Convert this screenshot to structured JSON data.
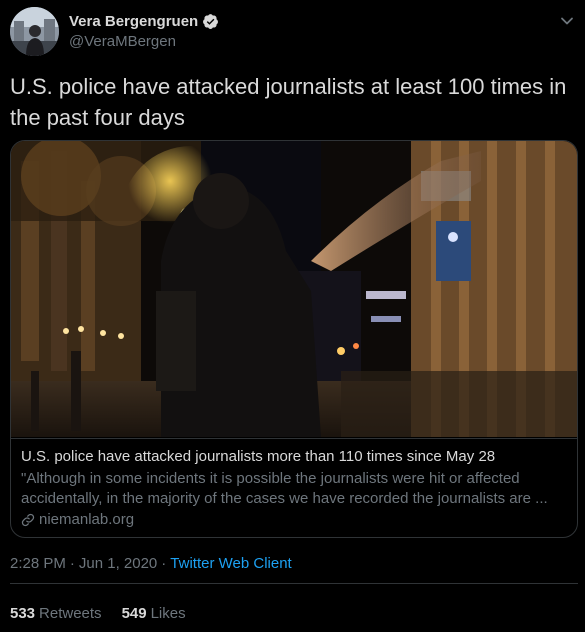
{
  "author": {
    "display_name": "Vera Bergengruen",
    "handle": "@VeraMBergen",
    "verified": true,
    "avatar_icon": "avatar-photo"
  },
  "tweet": {
    "text": "U.S. police have attacked journalists at least 100 times in the past four days"
  },
  "card": {
    "image_description_icon": "night-street-protest-photo",
    "title": "U.S. police have attacked journalists more than 110 times since May 28",
    "description_line1": "\"Although in some incidents it is possible the journalists were hit or affected",
    "description_line2": "accidentally, in the majority of the cases we have recorded the journalists are ...",
    "domain": "niemanlab.org"
  },
  "meta": {
    "time": "2:28 PM",
    "date": "Jun 1, 2020",
    "separator": "·",
    "client": "Twitter Web Client"
  },
  "stats": {
    "retweets_count": "533",
    "retweets_label": "Retweets",
    "likes_count": "549",
    "likes_label": "Likes"
  },
  "colors": {
    "background": "#000000",
    "text": "#d9d9d9",
    "secondary": "#6e767d",
    "accent": "#1da1f2",
    "border": "#2f3336"
  }
}
